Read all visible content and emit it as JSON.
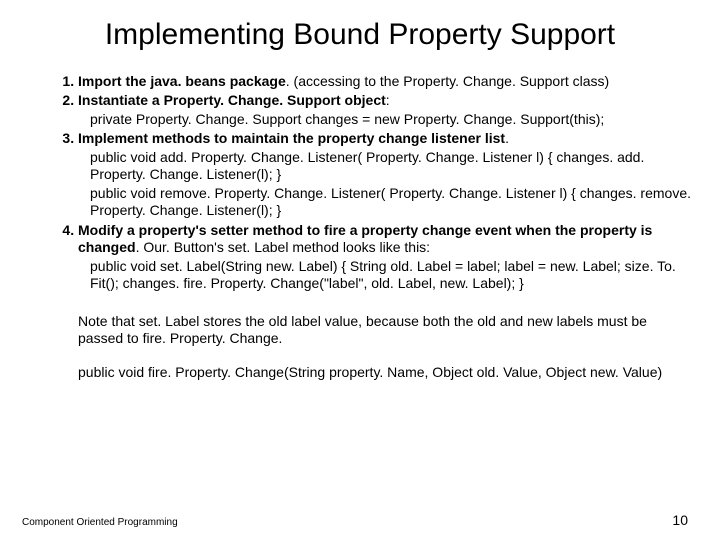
{
  "title": "Implementing Bound Property Support",
  "items": [
    {
      "lead_bold": "Import the java. beans package",
      "lead_rest": ". (accessing to the Property. Change. Support class)",
      "code": []
    },
    {
      "lead_bold": "Instantiate a Property. Change. Support object",
      "lead_rest": ":",
      "code": [
        "private Property. Change. Support changes = new Property. Change. Support(this);"
      ]
    },
    {
      "lead_bold": "Implement methods to maintain the property change listener list",
      "lead_rest": ".",
      "code": [
        "public void add. Property. Change. Listener( Property. Change. Listener l) { changes. add. Property. Change. Listener(l); }",
        "public void remove. Property. Change. Listener( Property. Change. Listener l) { changes. remove. Property. Change. Listener(l); }"
      ]
    },
    {
      "lead_bold": "Modify a property's setter method to fire a property change event when the property is changed",
      "lead_rest": ". Our. Button's set. Label method looks like this:",
      "code": [
        "public void set. Label(String new. Label) { String old. Label = label; label = new. Label; size. To. Fit(); changes. fire. Property. Change(\"label\", old. Label, new. Label); }"
      ]
    }
  ],
  "note": "Note that set. Label stores the old label value, because both the old and new labels must be passed to fire. Property. Change.",
  "sig": "public void fire. Property. Change(String property. Name, Object old. Value, Object new. Value)",
  "footer_left": "Component Oriented Programming",
  "footer_right": "10"
}
